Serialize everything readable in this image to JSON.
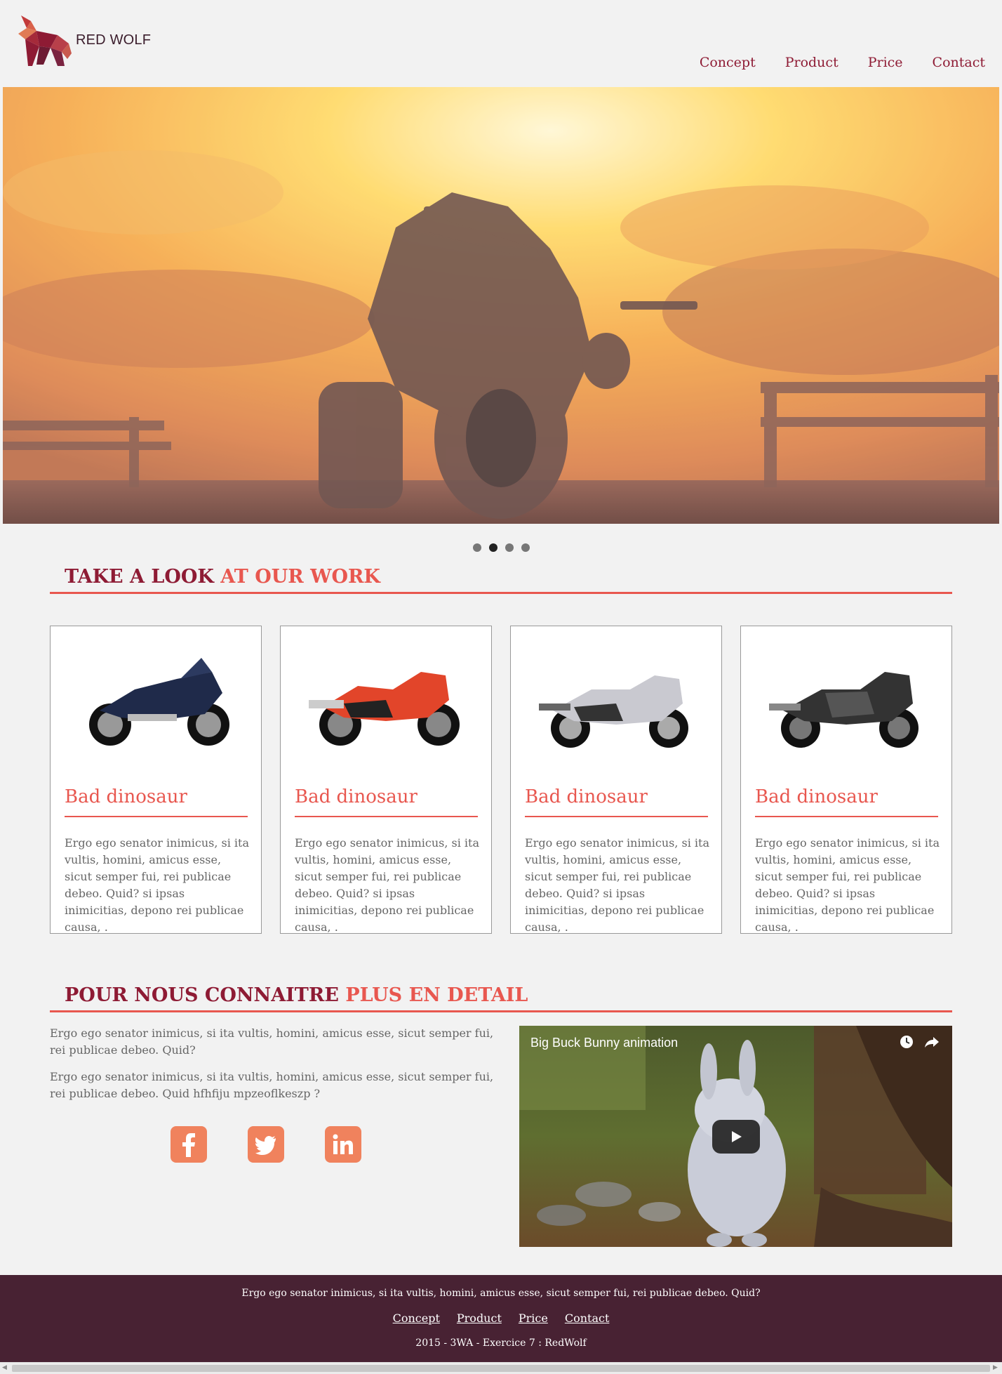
{
  "brand": {
    "name": "RED WOLF",
    "logo_icon": "wolf-logo-icon"
  },
  "nav": {
    "items": [
      "Concept",
      "Product",
      "Price",
      "Contact"
    ]
  },
  "carousel": {
    "slides": 4,
    "active_index": 1
  },
  "section_work": {
    "title_a": "TAKE A LOOK",
    "title_b": "AT OUR WORK"
  },
  "cards": [
    {
      "title": "Bad dinosaur",
      "text": "Ergo ego senator inimicus, si ita vultis, homini, amicus esse, sicut semper fui, rei publicae debeo. Quid? si ipsas inimicitias, depono rei publicae causa, .",
      "bike_color": "#1f2a4a"
    },
    {
      "title": "Bad dinosaur",
      "text": "Ergo ego senator inimicus, si ita vultis, homini, amicus esse, sicut semper fui, rei publicae debeo. Quid? si ipsas inimicitias, depono rei publicae causa, .",
      "bike_color": "#e2452a"
    },
    {
      "title": "Bad dinosaur",
      "text": "Ergo ego senator inimicus, si ita vultis, homini, amicus esse, sicut semper fui, rei publicae debeo. Quid? si ipsas inimicitias, depono rei publicae causa, .",
      "bike_color": "#c9c9d0"
    },
    {
      "title": "Bad dinosaur",
      "text": "Ergo ego senator inimicus, si ita vultis, homini, amicus esse, sicut semper fui, rei publicae debeo. Quid? si ipsas inimicitias, depono rei publicae causa, .",
      "bike_color": "#333333"
    }
  ],
  "section_about": {
    "title_a": "POUR NOUS CONNAITRE",
    "title_b": "PLUS EN DETAIL",
    "paragraphs": [
      "Ergo ego senator inimicus, si ita vultis, homini, amicus esse, sicut semper fui, rei publicae debeo. Quid?",
      "Ergo ego senator inimicus, si ita vultis, homini, amicus esse, sicut semper fui, rei publicae debeo. Quid hfhfiju mpzeoflkeszp ?"
    ],
    "socials": [
      "facebook-icon",
      "twitter-icon",
      "linkedin-icon"
    ]
  },
  "video": {
    "title": "Big Buck Bunny animation"
  },
  "footer": {
    "text": "Ergo ego senator inimicus, si ita vultis, homini, amicus esse, sicut semper fui, rei publicae debeo. Quid?",
    "nav": [
      "Concept",
      "Product",
      "Price",
      "Contact"
    ],
    "copy": "2015 - 3WA - Exercice 7 : RedWolf"
  },
  "colors": {
    "accent": "#e8574f",
    "brand_dark": "#8e1b34",
    "footer_bg": "#482233",
    "social": "#f0825d"
  }
}
